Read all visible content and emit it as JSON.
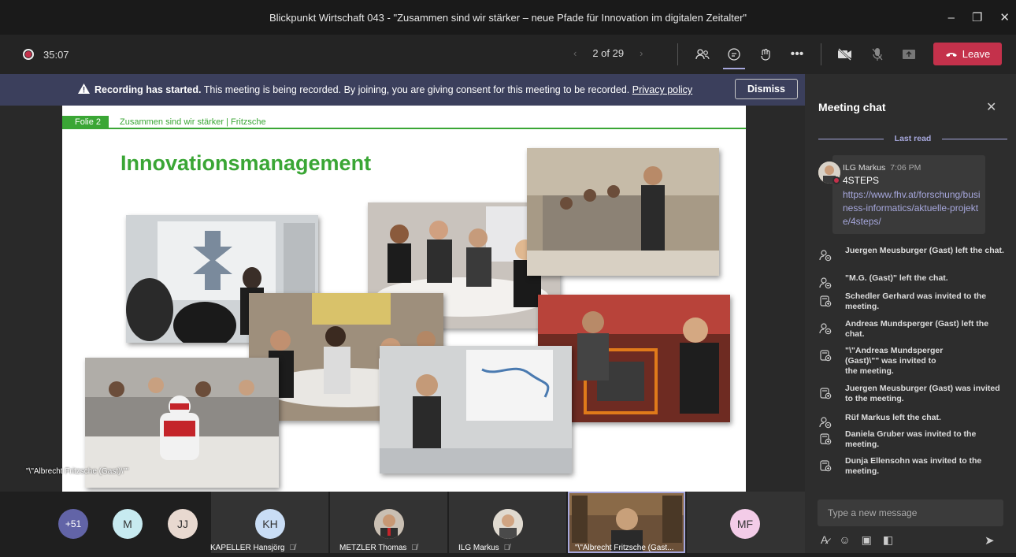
{
  "window": {
    "title": "Blickpunkt Wirtschaft 043 - \"Zusammen sind wir stärker – neue Pfade für Innovation im digitalen Zeitalter\"",
    "minimize": "–",
    "maximize": "❐",
    "close": "✕"
  },
  "toolbar": {
    "timer": "35:07",
    "prev": "‹",
    "page": "2 of 29",
    "next": "›",
    "more": "•••",
    "leave_label": "Leave"
  },
  "banner": {
    "bold": "Recording has started.",
    "text": " This meeting is being recorded. By joining, you are giving consent for this meeting to be recorded. ",
    "link": "Privacy policy",
    "dismiss": "Dismiss"
  },
  "slide": {
    "tag": "Folie 2",
    "subtitle": "Zusammen sind wir stärker | Fritzsche",
    "title": "Innovationsmanagement"
  },
  "presenter_overlay": "\"\\\"Albrecht Fritzsche (Gast)\\\"\"",
  "chat": {
    "title": "Meeting chat",
    "last_read": "Last read",
    "message": {
      "author": "ILG Markus",
      "time": "7:06 PM",
      "text": "4STEPS",
      "link": "https://www.fhv.at/forschung/business-informatics/aktuelle-projekte/4steps/"
    },
    "events": [
      {
        "type": "left",
        "text": "Juergen Meusburger (Gast) left the chat."
      },
      {
        "type": "left",
        "text": "\"M.G. (Gast)\" left the chat."
      },
      {
        "type": "invited",
        "text": "Schedler Gerhard was invited to the meeting."
      },
      {
        "type": "left",
        "text": "Andreas Mundsperger (Gast) left the chat."
      },
      {
        "type": "invited",
        "text": "\"\\\"Andreas Mundsperger (Gast)\\\"\" was invited to the meeting."
      },
      {
        "type": "invited",
        "text": "Juergen Meusburger (Gast) was invited to the meeting."
      },
      {
        "type": "left",
        "text": "Rüf Markus left the chat."
      },
      {
        "type": "invited",
        "text": "Daniela Gruber was invited to the meeting."
      },
      {
        "type": "invited",
        "text": "Dunja Ellensohn was invited to the meeting."
      }
    ],
    "input_placeholder": "Type a new message"
  },
  "gallery": {
    "overflow": "+51",
    "small_avatars": [
      "M",
      "JJ"
    ],
    "tiles": [
      {
        "initials": "KH",
        "name": "KAPELLER Hansjörg"
      },
      {
        "initials": "",
        "name": "METZLER Thomas"
      },
      {
        "initials": "",
        "name": "ILG Markus"
      },
      {
        "initials": "",
        "name": "\"\\\"Albrecht Fritzsche (Gast..."
      },
      {
        "initials": "MF",
        "name": ""
      }
    ]
  },
  "colors": {
    "accent": "#a6a7dc",
    "leave": "#c4314b",
    "slide_green": "#3aa635",
    "banner": "#3b3f5c"
  }
}
